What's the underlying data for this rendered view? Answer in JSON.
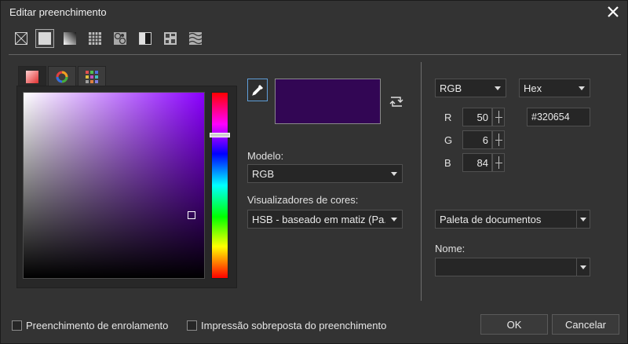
{
  "window": {
    "title": "Editar preenchimento"
  },
  "toolbar": {
    "buttons": [
      {
        "name": "no-fill-icon"
      },
      {
        "name": "uniform-fill-icon",
        "active": true
      },
      {
        "name": "fountain-fill-icon"
      },
      {
        "name": "vector-pattern-fill-icon"
      },
      {
        "name": "bitmap-pattern-fill-icon"
      },
      {
        "name": "two-color-pattern-fill-icon"
      },
      {
        "name": "texture-fill-icon"
      },
      {
        "name": "postscript-fill-icon"
      }
    ]
  },
  "tabs": [
    {
      "name": "color-viewers-tab-icon",
      "active": true
    },
    {
      "name": "color-harmonies-tab-icon"
    },
    {
      "name": "color-palettes-tab-icon"
    }
  ],
  "current_color": "#320654",
  "hue_level": 0.23,
  "model": {
    "label": "Modelo:",
    "value": "RGB"
  },
  "viewers": {
    "label": "Visualizadores de cores:",
    "value": "HSB - baseado em matiz (Pa..."
  },
  "color_model_select": "RGB",
  "format_select": "Hex",
  "channels": [
    {
      "label": "R",
      "value": "50"
    },
    {
      "label": "G",
      "value": "6"
    },
    {
      "label": "B",
      "value": "84"
    }
  ],
  "hex_value": "#320654",
  "palette": {
    "value": "Paleta de documentos"
  },
  "name_field": {
    "label": "Nome:",
    "value": ""
  },
  "footer": {
    "wrap_fill": "Preenchimento de enrolamento",
    "overprint_fill": "Impressão sobreposta do preenchimento",
    "ok": "OK",
    "cancel": "Cancelar"
  }
}
